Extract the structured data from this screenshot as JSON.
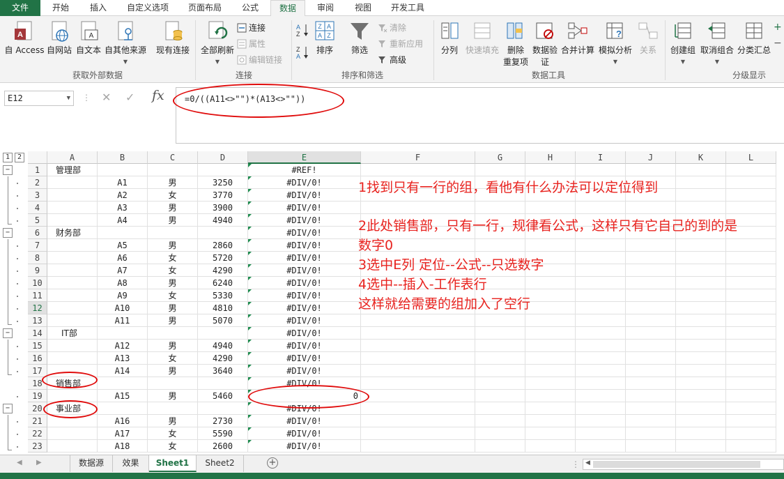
{
  "ribbon_tabs": [
    "文件",
    "开始",
    "插入",
    "自定义选项",
    "页面布局",
    "公式",
    "数据",
    "审阅",
    "视图",
    "开发工具"
  ],
  "active_tab": "数据",
  "ribbon": {
    "get_external": {
      "access": "自 Access",
      "web": "自网站",
      "text": "自文本",
      "other": "自其他来源",
      "existing": "现有连接",
      "group": "获取外部数据"
    },
    "connections": {
      "refresh_all": "全部刷新",
      "connections": "连接",
      "properties": "属性",
      "edit_links": "编辑链接",
      "group": "连接"
    },
    "sort_filter": {
      "sort": "排序",
      "filter": "筛选",
      "clear": "清除",
      "reapply": "重新应用",
      "advanced": "高级",
      "group": "排序和筛选"
    },
    "data_tools": {
      "text_to_columns": "分列",
      "flash_fill": "快速填充",
      "remove_dup_1": "删除",
      "remove_dup_2": "重复项",
      "validation_1": "数据验",
      "validation_2": "证",
      "consolidate": "合并计算",
      "what_if": "模拟分析",
      "relationships": "关系",
      "group": "数据工具"
    },
    "outline": {
      "group_btn": "创建组",
      "ungroup": "取消组合",
      "subtotal": "分类汇总",
      "group": "分级显示"
    }
  },
  "name_box": "E12",
  "formula": "=0/((A11<>\"\")*(A13<>\"\"))",
  "columns": [
    "A",
    "B",
    "C",
    "D",
    "E",
    "F",
    "G",
    "H",
    "I",
    "J",
    "K",
    "L"
  ],
  "outline_levels": [
    "1",
    "2"
  ],
  "rows": [
    {
      "n": "1",
      "a": "管理部",
      "b": "",
      "c": "",
      "d": "",
      "e": "#REF!"
    },
    {
      "n": "2",
      "a": "",
      "b": "A1",
      "c": "男",
      "d": "3250",
      "e": "#DIV/0!"
    },
    {
      "n": "3",
      "a": "",
      "b": "A2",
      "c": "女",
      "d": "3770",
      "e": "#DIV/0!"
    },
    {
      "n": "4",
      "a": "",
      "b": "A3",
      "c": "男",
      "d": "3900",
      "e": "#DIV/0!"
    },
    {
      "n": "5",
      "a": "",
      "b": "A4",
      "c": "男",
      "d": "4940",
      "e": "#DIV/0!"
    },
    {
      "n": "6",
      "a": "财务部",
      "b": "",
      "c": "",
      "d": "",
      "e": "#DIV/0!"
    },
    {
      "n": "7",
      "a": "",
      "b": "A5",
      "c": "男",
      "d": "2860",
      "e": "#DIV/0!"
    },
    {
      "n": "8",
      "a": "",
      "b": "A6",
      "c": "女",
      "d": "5720",
      "e": "#DIV/0!"
    },
    {
      "n": "9",
      "a": "",
      "b": "A7",
      "c": "女",
      "d": "4290",
      "e": "#DIV/0!"
    },
    {
      "n": "10",
      "a": "",
      "b": "A8",
      "c": "男",
      "d": "6240",
      "e": "#DIV/0!"
    },
    {
      "n": "11",
      "a": "",
      "b": "A9",
      "c": "女",
      "d": "5330",
      "e": "#DIV/0!"
    },
    {
      "n": "12",
      "a": "",
      "b": "A10",
      "c": "男",
      "d": "4810",
      "e": "#DIV/0!"
    },
    {
      "n": "13",
      "a": "",
      "b": "A11",
      "c": "男",
      "d": "5070",
      "e": "#DIV/0!"
    },
    {
      "n": "14",
      "a": "IT部",
      "b": "",
      "c": "",
      "d": "",
      "e": "#DIV/0!"
    },
    {
      "n": "15",
      "a": "",
      "b": "A12",
      "c": "男",
      "d": "4940",
      "e": "#DIV/0!"
    },
    {
      "n": "16",
      "a": "",
      "b": "A13",
      "c": "女",
      "d": "4290",
      "e": "#DIV/0!"
    },
    {
      "n": "17",
      "a": "",
      "b": "A14",
      "c": "男",
      "d": "3640",
      "e": "#DIV/0!"
    },
    {
      "n": "18",
      "a": "销售部",
      "b": "",
      "c": "",
      "d": "",
      "e": "#DIV/0!"
    },
    {
      "n": "19",
      "a": "",
      "b": "A15",
      "c": "男",
      "d": "5460",
      "e": "0"
    },
    {
      "n": "20",
      "a": "事业部",
      "b": "",
      "c": "",
      "d": "",
      "e": "#DIV/0!"
    },
    {
      "n": "21",
      "a": "",
      "b": "A16",
      "c": "男",
      "d": "2730",
      "e": "#DIV/0!"
    },
    {
      "n": "22",
      "a": "",
      "b": "A17",
      "c": "女",
      "d": "5590",
      "e": "#DIV/0!"
    },
    {
      "n": "23",
      "a": "",
      "b": "A18",
      "c": "女",
      "d": "2600",
      "e": "#DIV/0!"
    }
  ],
  "notes": [
    "1找到只有一行的组，看他有什么办法可以定位得到",
    "2此处销售部，只有一行，规律看公式，这样只有它自己的到的是",
    "数字0",
    "3选中E列  定位--公式--只选数字",
    "4选中--插入-工作表行",
    "这样就给需要的组加入了空行"
  ],
  "sheet_tabs": [
    "数据源",
    "效果",
    "Sheet1",
    "Sheet2"
  ],
  "active_sheet": "Sheet1",
  "colors": {
    "excel_green": "#217346",
    "annotation_red": "#e8231f"
  }
}
